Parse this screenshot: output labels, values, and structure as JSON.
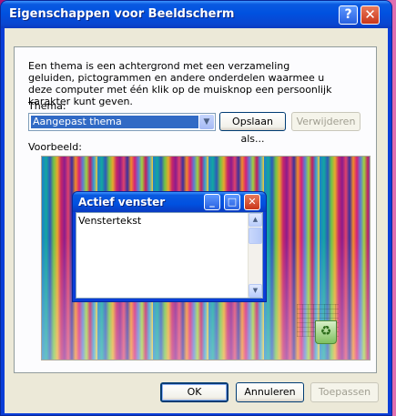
{
  "window": {
    "title": "Eigenschappen voor Beeldscherm",
    "help_glyph": "?",
    "close_glyph": "✕"
  },
  "theme_page": {
    "description": "Een thema is een achtergrond met een verzameling geluiden, pictogrammen en andere onderdelen waarmee u deze computer met één klik op de muisknop een persoonlijk karakter kunt geven.",
    "theme_label": "Thema:",
    "theme_value": "Aangepast thema",
    "save_as_label": "Opslaan als...",
    "delete_label": "Verwijderen",
    "preview_label": "Voorbeeld:"
  },
  "preview": {
    "window_title": "Actief venster",
    "window_text": "Venstertekst"
  },
  "footer": {
    "ok_label": "OK",
    "cancel_label": "Annuleren",
    "apply_label": "Toepassen"
  },
  "colors": {
    "title_bar": "#0a5ae0",
    "dialog_bg": "#ece9d8",
    "selection": "#316ac5"
  }
}
